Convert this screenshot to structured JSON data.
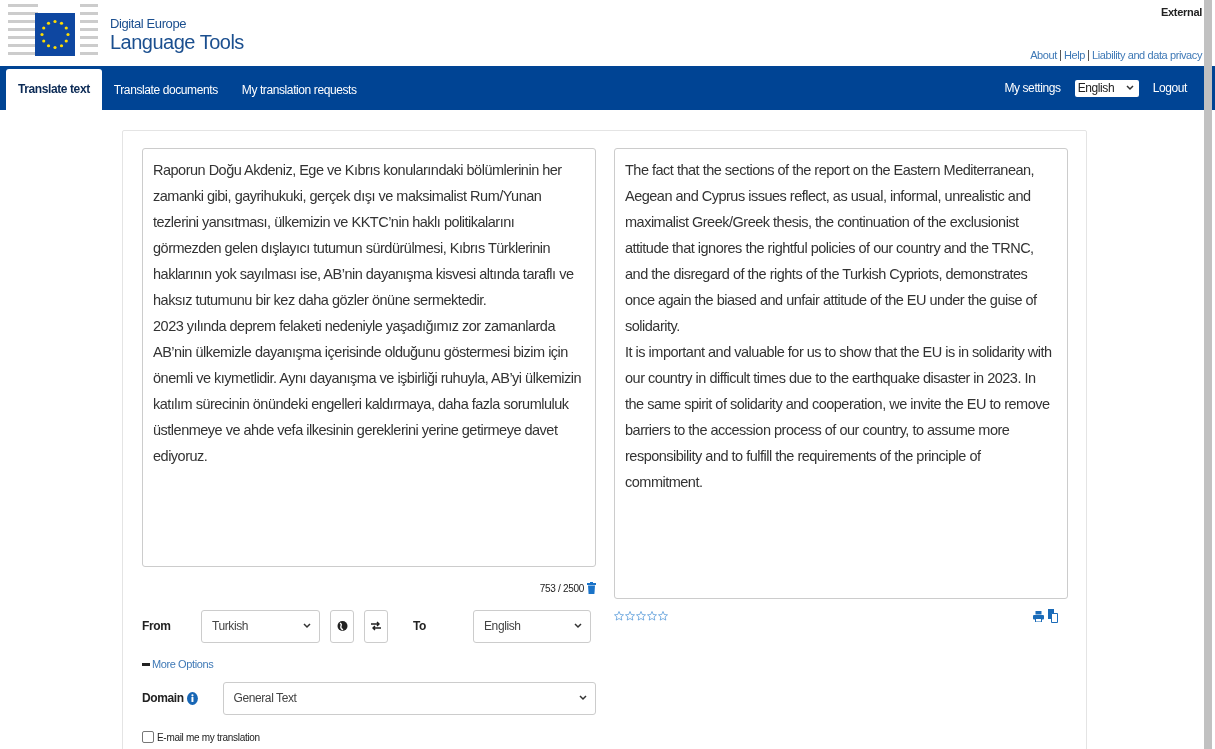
{
  "header": {
    "subtitle": "Digital Europe",
    "title": "Language Tools",
    "environment": "External",
    "links": [
      {
        "label": "About"
      },
      {
        "label": "Help"
      },
      {
        "label": "Liability and data privacy"
      }
    ]
  },
  "nav": {
    "tabs": [
      {
        "label": "Translate text",
        "selected": true
      },
      {
        "label": "Translate documents",
        "selected": false
      },
      {
        "label": "My translation requests",
        "selected": false
      }
    ],
    "settings": "My settings",
    "language": "English",
    "logout": "Logout"
  },
  "source": {
    "paragraphs": [
      "Raporun Doğu Akdeniz, Ege ve Kıbrıs konularındaki bölümlerinin her zamanki gibi, gayrihukuki, gerçek dışı ve maksimalist Rum/Yunan tezlerini yansıtması, ülkemizin ve KKTC’nin haklı politikalarını görmezden gelen dışlayıcı tutumun sürdürülmesi, Kıbrıs Türklerinin haklarının yok sayılması ise, AB’nin dayanışma kisvesi altında taraflı ve haksız tutumunu bir kez daha gözler önüne sermektedir.",
      "2023 yılında deprem felaketi nedeniyle yaşadığımız zor zamanlarda AB’nin ülkemizle dayanışma içerisinde olduğunu göstermesi bizim için önemli ve kıymetlidir. Aynı dayanışma ve işbirliği ruhuyla, AB’yi ülkemizin katılım sürecinin önündeki engelleri kaldırmaya, daha fazla sorumluluk üstlenmeye ve ahde vefa ilkesinin gereklerini yerine getirmeye davet ediyoruz."
    ],
    "counter": "753 / 2500"
  },
  "controls": {
    "from_label": "From",
    "from": "Turkish",
    "to_label": "To",
    "to": "English",
    "more_options": "More Options",
    "domain_label": "Domain",
    "domain": "General Text",
    "email": {
      "label": "E-mail me my translation",
      "checked": false
    }
  },
  "target": {
    "paragraphs": [
      "The fact that the sections of the report on the Eastern Mediterranean, Aegean and Cyprus issues reflect, as usual, informal, unrealistic and maximalist Greek/Greek thesis, the continuation of the exclusionist attitude that ignores the rightful policies of our country and the TRNC, and the disregard of the rights of the Turkish Cypriots, demonstrates once again the biased and unfair attitude of the EU under the guise of solidarity.",
      "It is important and valuable for us to show that the EU is in solidarity with our country in difficult times due to the earthquake disaster in 2023. In the same spirit of solidarity and cooperation, we invite the EU to remove barriers to the accession process of our country, to assume more responsibility and to fulfill the requirements of the principle of commitment."
    ],
    "stars": 0
  }
}
